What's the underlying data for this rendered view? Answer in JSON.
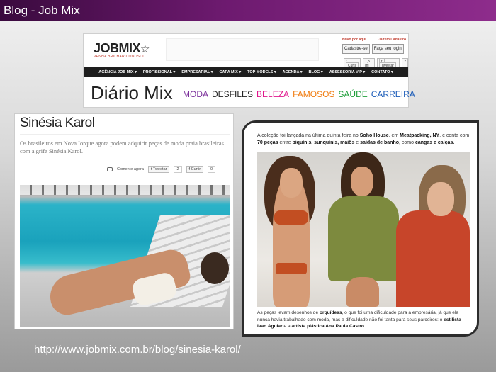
{
  "slide": {
    "title": "Blog - Job Mix",
    "url": "http://www.jobmix.com.br/blog/sinesia-karol/"
  },
  "header_shot": {
    "logo_text": "JOBMIX",
    "logo_tagline": "VENHA BRILHAR CONOSCO",
    "login_label_new": "Novo por aqui",
    "login_label_registered": "Já tem Cadastro",
    "login_btn_register": "Cadastre-se",
    "login_btn_login": "Faça seu login",
    "social_like": "Curtir",
    "social_like_count": "1,5 mi",
    "social_tweet": "Tweetar",
    "social_tweet_count": "2",
    "nav_items": [
      "AGÊNCIA JOB MIX ▾",
      "PROFISSIONAL ▾",
      "EMPRESARIAL ▾",
      "CAPA MIX ▾",
      "TOP MODELS ▾",
      "AGENDA ▾",
      "BLOG ▾",
      "ASSESSORIA VIP ▾",
      "CONTATO ▾"
    ],
    "diario_title": "Diário Mix",
    "categories": [
      {
        "label": "MODA",
        "color": "#7a2e9a"
      },
      {
        "label": "DESFILES",
        "color": "#222222"
      },
      {
        "label": "BELEZA",
        "color": "#e0168c"
      },
      {
        "label": "FAMOSOS",
        "color": "#f07c10"
      },
      {
        "label": "SAÚDE",
        "color": "#1f9e3a"
      },
      {
        "label": "CARREIRA",
        "color": "#1a5bb8"
      }
    ]
  },
  "article_left": {
    "title": "Sinésia Karol",
    "lead": "Os brasileiros em Nova Iorque agora podem adquirir peças de moda praia brasileiras com a grife Sinésia Karol.",
    "comment_label": "Comente agora",
    "tweet_label": "Tweetar",
    "tweet_count": "2",
    "like_label": "Curtir",
    "like_count": "0",
    "photo_icon": "pool-photo"
  },
  "article_right": {
    "intro_1": "A coleção foi lançada na última quinta feira no ",
    "intro_soho": "Soho House",
    "intro_2": ", em ",
    "intro_meat": "Meatpacking, NY",
    "intro_3": ", e conta com ",
    "intro_70": "70 peças",
    "intro_4": " entre ",
    "intro_list": "biquínis, sunquínis, maiôs",
    "intro_5": " e ",
    "intro_saidas": "saídas de banho",
    "intro_6": ", como ",
    "intro_cangas": "cangas e calças.",
    "outro_1": "As peças levam desenhos de ",
    "outro_orq": "orquídeas",
    "outro_2": ", o que foi uma dificuldade para a empresária, já que ela nunca havia trabalhado com moda, mas a dificuldade não foi tanta para seus parceiros: o ",
    "outro_stylist": "estilista Ivan Aguiar",
    "outro_3": " e a ",
    "outro_artist": "artista plástica Ana Paula Castro",
    "outro_4": ".",
    "photo_icon": "runway-photo"
  }
}
